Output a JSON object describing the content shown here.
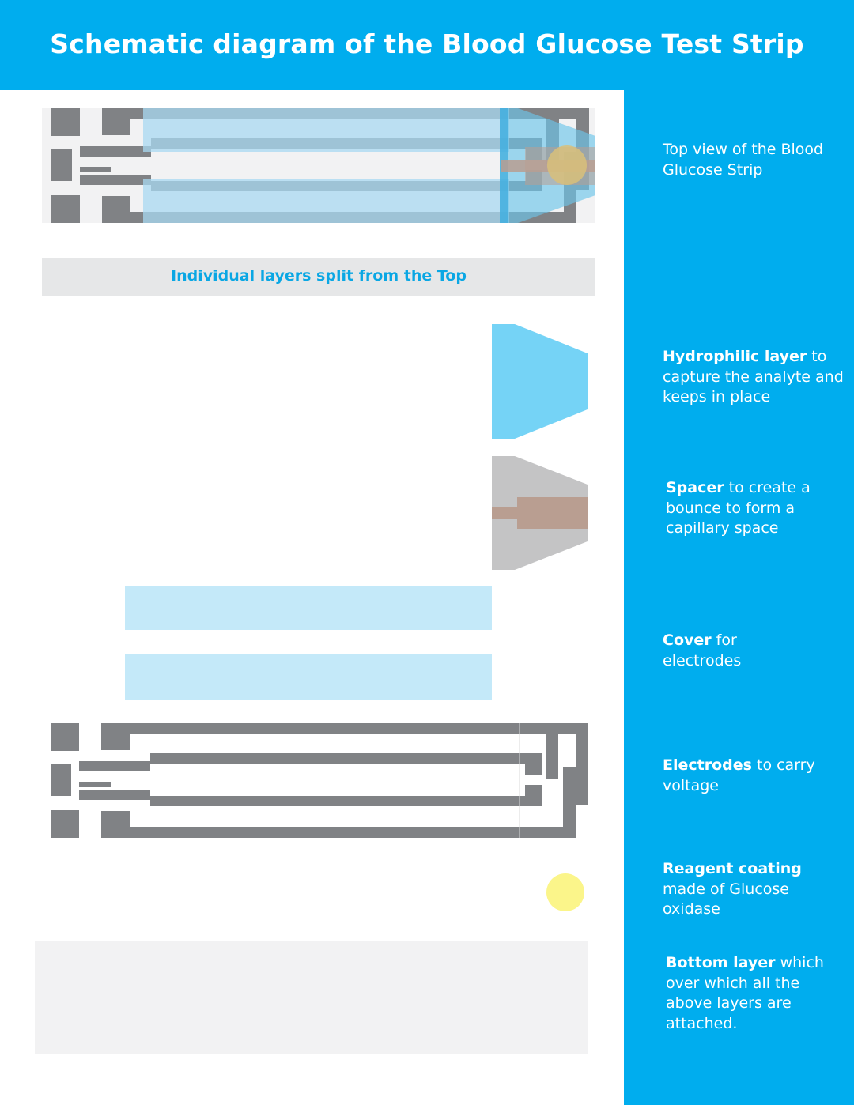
{
  "title": "Schematic diagram of the Blood Glucose Test Strip",
  "banner": "Individual layers split from the Top",
  "descriptions": {
    "top_view": {
      "bold": "",
      "text": "Top view of the Blood Glucose Strip"
    },
    "hydrophilic": {
      "bold": "Hydrophilic layer",
      "text": " to capture the analyte and keeps in place"
    },
    "spacer": {
      "bold": "Spacer",
      "text": " to create a bounce to form a capillary space"
    },
    "cover": {
      "bold": "Cover",
      "text": " for electrodes"
    },
    "electrodes": {
      "bold": "Electrodes",
      "text": " to carry voltage"
    },
    "reagent": {
      "bold": "Reagent coating",
      "text": " made of Glucose oxidase"
    },
    "bottom": {
      "bold": "Bottom layer",
      "text": " which over which all the above layers are attached."
    }
  },
  "colors": {
    "header": "#00adee",
    "sidebar": "#00adee",
    "electrode": "#808285",
    "cover": "#c4e9f9",
    "hydrophilic": "#75d3f6",
    "spacer": "#c4c4c5",
    "channel": "#b99e91",
    "reagent": "#fbf58a",
    "bottom_layer": "#f2f2f3",
    "banner_bg": "#e6e7e8",
    "banner_text": "#0aa7e4"
  }
}
